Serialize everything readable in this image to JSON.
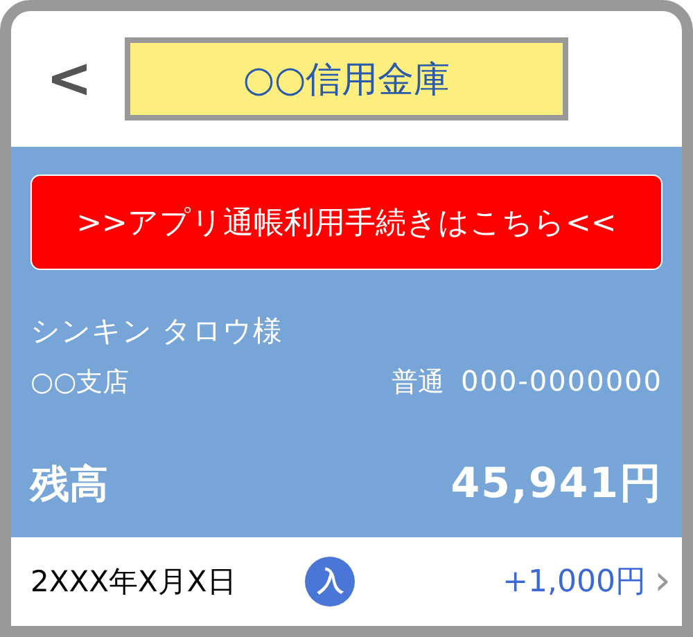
{
  "header": {
    "back": "<",
    "title": "○○信用金庫"
  },
  "banner_button": {
    "label": ">>アプリ通帳利用手続きはこちら<<"
  },
  "account": {
    "holder": "シンキン タロウ様",
    "branch": "○○支店",
    "type": "普通",
    "number": "000-0000000",
    "balance_label": "残高",
    "balance": "45,941円"
  },
  "transaction": {
    "date": "2XXX年X月X日",
    "badge": "入",
    "amount": "+1,000円",
    "chevron": "›"
  }
}
